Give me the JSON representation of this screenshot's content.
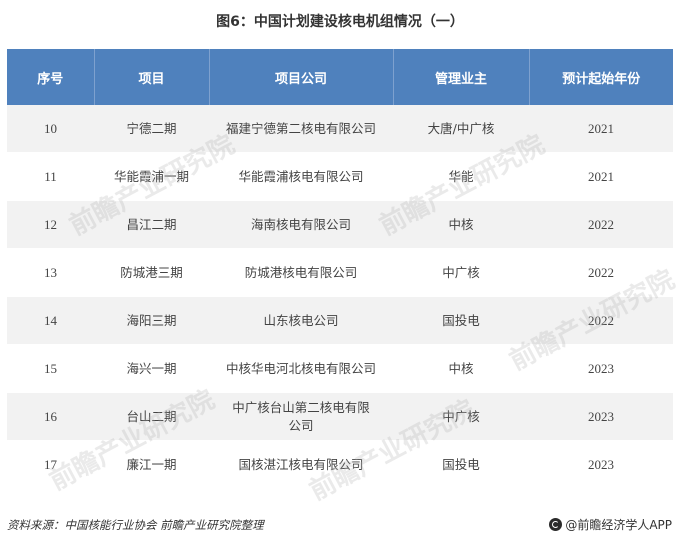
{
  "title": "图6：中国计划建设核电机组情况（一）",
  "table": {
    "headers": [
      "序号",
      "项目",
      "项目公司",
      "管理业主",
      "预计起始年份"
    ],
    "rows": [
      {
        "no": "10",
        "project": "宁德二期",
        "company": "福建宁德第二核电有限公司",
        "owner": "大唐/中广核",
        "year": "2021"
      },
      {
        "no": "11",
        "project": "华能霞浦一期",
        "company": "华能霞浦核电有限公司",
        "owner": "华能",
        "year": "2021"
      },
      {
        "no": "12",
        "project": "昌江二期",
        "company": "海南核电有限公司",
        "owner": "中核",
        "year": "2022"
      },
      {
        "no": "13",
        "project": "防城港三期",
        "company": "防城港核电有限公司",
        "owner": "中广核",
        "year": "2022"
      },
      {
        "no": "14",
        "project": "海阳三期",
        "company": "山东核电公司",
        "owner": "国投电",
        "year": "2022"
      },
      {
        "no": "15",
        "project": "海兴一期",
        "company": "中核华电河北核电有限公司",
        "owner": "中核",
        "year": "2023"
      },
      {
        "no": "16",
        "project": "台山二期",
        "company": "中广核台山第二核电有限公司",
        "owner": "中广核",
        "year": "2023"
      },
      {
        "no": "17",
        "project": "廉江一期",
        "company": "国核湛江核电有限公司",
        "owner": "国投电",
        "year": "2023"
      }
    ]
  },
  "footer": {
    "source": "资料来源：中国核能行业协会  前瞻产业研究院整理",
    "brand": "@前瞻经济学人APP"
  },
  "watermark_text": "前瞻产业研究院",
  "colors": {
    "header_bg": "#4f81bd",
    "stripe": "#f2f2f2"
  }
}
